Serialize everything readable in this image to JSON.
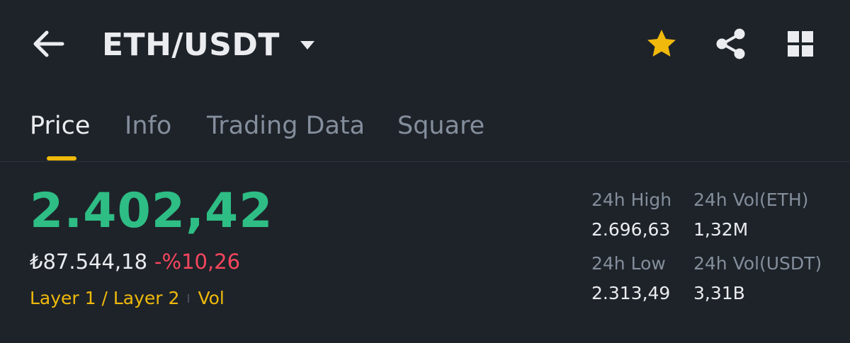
{
  "header": {
    "pair": "ETH/USDT",
    "back_icon": "arrow-left-icon",
    "caret_icon": "caret-down-icon",
    "favorite_icon": "star-icon",
    "share_icon": "share-icon",
    "grid_icon": "grid-icon",
    "favorite_color": "#f0b90b"
  },
  "tabs": [
    {
      "label": "Price",
      "active": true
    },
    {
      "label": "Info",
      "active": false
    },
    {
      "label": "Trading Data",
      "active": false
    },
    {
      "label": "Square",
      "active": false
    }
  ],
  "ticker": {
    "last_price": "2.402,42",
    "local_price": "₺87.544,18",
    "change_pct": "-%10,26",
    "tags": [
      "Layer 1 / Layer 2",
      "Vol"
    ],
    "up_color": "#2ebd85",
    "down_color": "#f6465d",
    "accent_color": "#f0b90b"
  },
  "stats": {
    "high_label": "24h High",
    "high_value": "2.696,63",
    "low_label": "24h Low",
    "low_value": "2.313,49",
    "vol_base_label": "24h Vol(ETH)",
    "vol_base_value": "1,32M",
    "vol_quote_label": "24h Vol(USDT)",
    "vol_quote_value": "3,31B"
  }
}
